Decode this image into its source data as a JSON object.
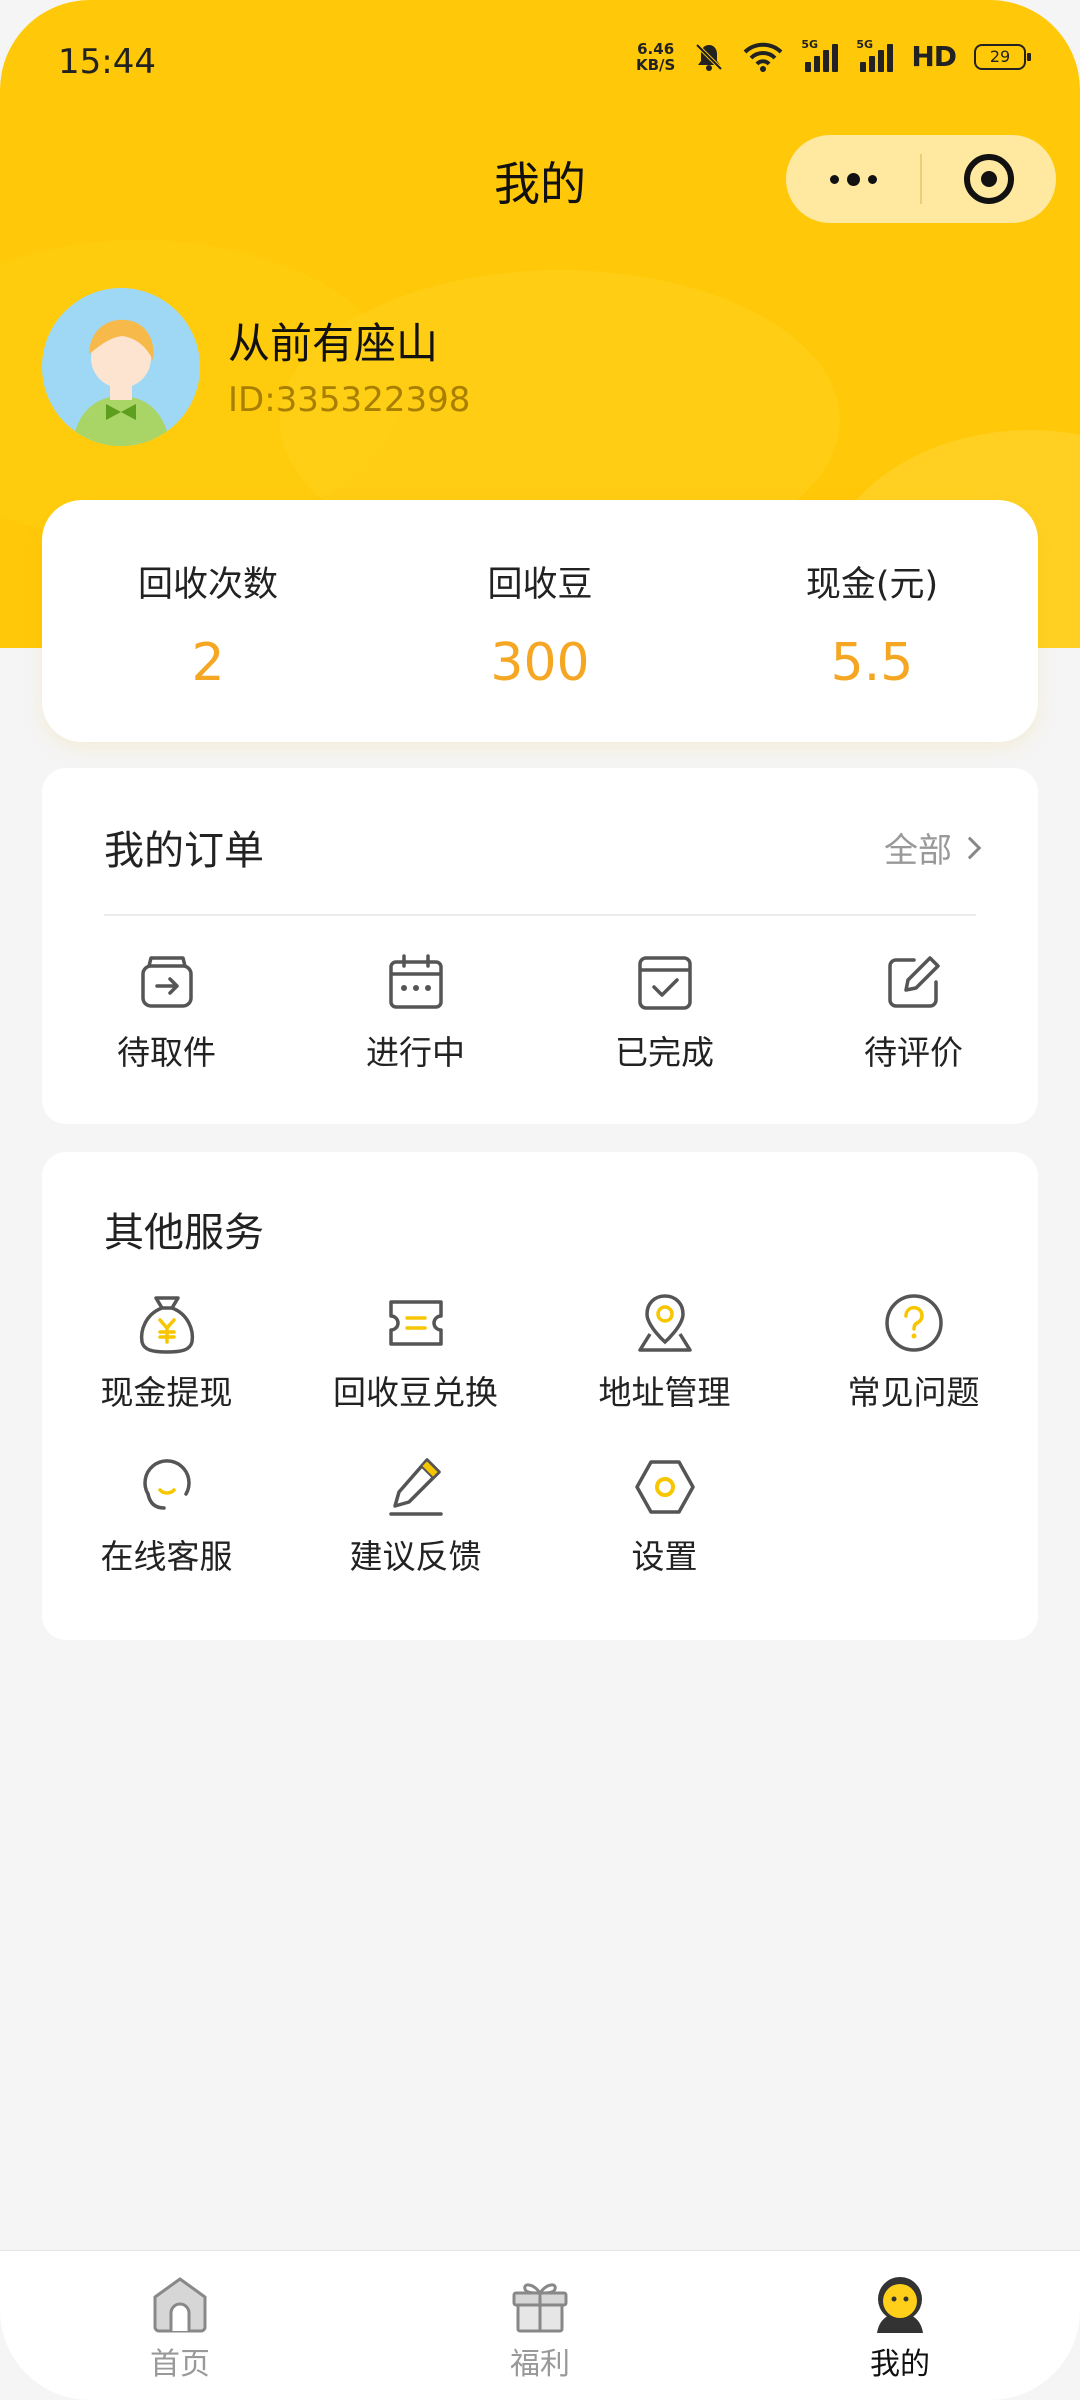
{
  "status_bar": {
    "time": "15:44",
    "net_speed_value": "6.46",
    "net_speed_unit": "KB/S",
    "signal_tag": "5G",
    "hd": "HD",
    "battery": "29"
  },
  "nav": {
    "title": "我的"
  },
  "user": {
    "name": "从前有座山",
    "id": "ID:335322398"
  },
  "stats": [
    {
      "label": "回收次数",
      "value": "2"
    },
    {
      "label": "回收豆",
      "value": "300"
    },
    {
      "label": "现金(元)",
      "value": "5.5"
    }
  ],
  "orders": {
    "title": "我的订单",
    "view_all": "全部",
    "items": [
      {
        "label": "待取件",
        "icon": "pickup-icon"
      },
      {
        "label": "进行中",
        "icon": "calendar-icon"
      },
      {
        "label": "已完成",
        "icon": "completed-icon"
      },
      {
        "label": "待评价",
        "icon": "edit-icon"
      }
    ]
  },
  "services": {
    "title": "其他服务",
    "items": [
      {
        "label": "现金提现",
        "icon": "money-bag-icon"
      },
      {
        "label": "回收豆兑换",
        "icon": "ticket-icon"
      },
      {
        "label": "地址管理",
        "icon": "location-icon"
      },
      {
        "label": "常见问题",
        "icon": "question-icon"
      },
      {
        "label": "在线客服",
        "icon": "headset-icon"
      },
      {
        "label": "建议反馈",
        "icon": "pen-icon"
      },
      {
        "label": "设置",
        "icon": "settings-hex-icon"
      }
    ]
  },
  "tabs": [
    {
      "label": "首页",
      "icon": "home-icon"
    },
    {
      "label": "福利",
      "icon": "gift-icon"
    },
    {
      "label": "我的",
      "icon": "profile-icon",
      "active": true
    }
  ],
  "colors": {
    "header": "#ffc808",
    "accent_value": "#f5a623",
    "icon_accent": "#f7c600",
    "icon_stroke": "#555555"
  }
}
